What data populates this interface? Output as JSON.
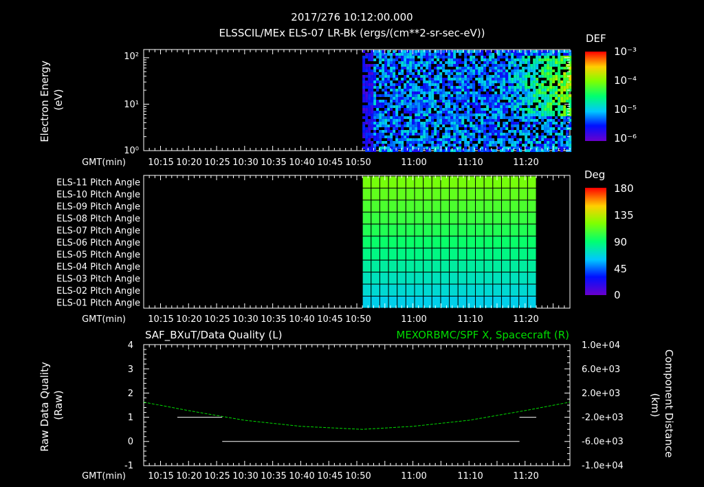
{
  "header": {
    "title": "2017/276 10:12:00.000",
    "subtitle": "ELSSCIL/MEx ELS-07 LR-Bk  (ergs/(cm**2-sr-sec-eV))"
  },
  "time_axis": {
    "label": "GMT(min)",
    "ticks_left": [
      "10:15",
      "10:20",
      "10:25",
      "10:30",
      "10:35",
      "10:40",
      "10:45",
      "10:50"
    ],
    "ticks_right": [
      "11:00",
      "11:10",
      "11:20"
    ]
  },
  "colors": {
    "background": "#000000",
    "axes": "#ffffff",
    "grid": "#000000",
    "spacecraft_trace": "#00dd00",
    "quality_trace": "#ffffff"
  },
  "chart_data": [
    {
      "type": "heatmap",
      "name": "energy-spectrogram",
      "ylabel": "Electron Energy\n(eV)",
      "y_scale": "log",
      "ylim": [
        1,
        150
      ],
      "y_ticks": [
        "10⁰",
        "10¹",
        "10²"
      ],
      "colorbar": {
        "title": "DEF",
        "scale": "log",
        "range": [
          1e-06,
          0.001
        ],
        "ticks": [
          "10⁻³",
          "10⁻⁴",
          "10⁻⁵",
          "10⁻⁶"
        ]
      },
      "data_start_time": "10:51",
      "data_end_time": "11:28"
    },
    {
      "type": "heatmap",
      "name": "pitch-angle",
      "rows": [
        "ELS-11 Pitch Angle",
        "ELS-10 Pitch Angle",
        "ELS-09 Pitch Angle",
        "ELS-08 Pitch Angle",
        "ELS-07 Pitch Angle",
        "ELS-06 Pitch Angle",
        "ELS-05 Pitch Angle",
        "ELS-04 Pitch Angle",
        "ELS-03 Pitch Angle",
        "ELS-02 Pitch Angle",
        "ELS-01 Pitch Angle"
      ],
      "values_deg": [
        118,
        113,
        108,
        103,
        98,
        92,
        86,
        80,
        74,
        69,
        64
      ],
      "colorbar": {
        "title": "Deg",
        "range": [
          0,
          180
        ],
        "ticks": [
          "180",
          "135",
          "90",
          "45",
          "0"
        ]
      },
      "data_start_time": "10:51",
      "data_end_time": "11:22"
    },
    {
      "type": "line",
      "name": "quality-and-position",
      "title_left": "SAF_BXuT/Data Quality (L)",
      "title_right": "MEXORBMC/SPF X, Spacecraft (R)",
      "ylabel_left": "Raw Data Quality\n(Raw)",
      "ylabel_right": "Component Distance\n(km)",
      "ylim_left": [
        -1,
        4
      ],
      "left_ticks": [
        "4",
        "3",
        "2",
        "1",
        "0",
        "-1"
      ],
      "ylim_right": [
        -10000,
        10000
      ],
      "right_ticks": [
        "1.0e+04",
        "6.0e+03",
        "2.0e+03",
        "-2.0e+03",
        "-6.0e+03",
        "-1.0e+04"
      ],
      "series": [
        {
          "name": "SAF_BXuT/Data Quality",
          "axis": "left",
          "segments": [
            {
              "x": [
                "10:18",
                "10:26"
              ],
              "y": [
                1,
                1
              ]
            },
            {
              "x": [
                "10:26",
                "11:19"
              ],
              "y": [
                0,
                0
              ]
            },
            {
              "x": [
                "11:19",
                "11:22"
              ],
              "y": [
                1,
                1
              ]
            }
          ]
        },
        {
          "name": "MEXORBMC/SPF X, Spacecraft",
          "axis": "right",
          "x": [
            "10:12",
            "10:20",
            "10:30",
            "10:40",
            "10:51",
            "11:00",
            "11:10",
            "11:20",
            "11:28"
          ],
          "y": [
            500,
            -900,
            -2500,
            -3500,
            -4000,
            -3500,
            -2500,
            -900,
            500
          ]
        }
      ]
    }
  ]
}
